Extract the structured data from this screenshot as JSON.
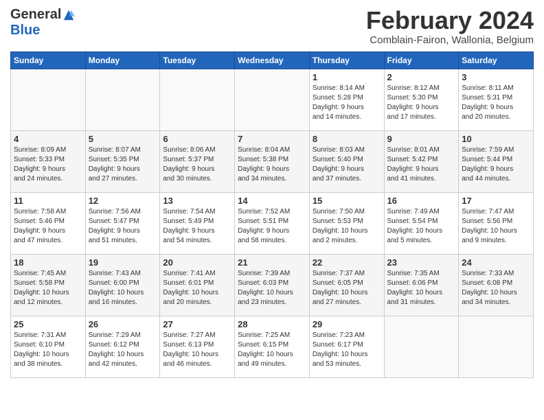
{
  "header": {
    "logo_general": "General",
    "logo_blue": "Blue",
    "month_title": "February 2024",
    "location": "Comblain-Fairon, Wallonia, Belgium"
  },
  "columns": [
    "Sunday",
    "Monday",
    "Tuesday",
    "Wednesday",
    "Thursday",
    "Friday",
    "Saturday"
  ],
  "weeks": [
    [
      {
        "day": "",
        "info": ""
      },
      {
        "day": "",
        "info": ""
      },
      {
        "day": "",
        "info": ""
      },
      {
        "day": "",
        "info": ""
      },
      {
        "day": "1",
        "info": "Sunrise: 8:14 AM\nSunset: 5:28 PM\nDaylight: 9 hours\nand 14 minutes."
      },
      {
        "day": "2",
        "info": "Sunrise: 8:12 AM\nSunset: 5:30 PM\nDaylight: 9 hours\nand 17 minutes."
      },
      {
        "day": "3",
        "info": "Sunrise: 8:11 AM\nSunset: 5:31 PM\nDaylight: 9 hours\nand 20 minutes."
      }
    ],
    [
      {
        "day": "4",
        "info": "Sunrise: 8:09 AM\nSunset: 5:33 PM\nDaylight: 9 hours\nand 24 minutes."
      },
      {
        "day": "5",
        "info": "Sunrise: 8:07 AM\nSunset: 5:35 PM\nDaylight: 9 hours\nand 27 minutes."
      },
      {
        "day": "6",
        "info": "Sunrise: 8:06 AM\nSunset: 5:37 PM\nDaylight: 9 hours\nand 30 minutes."
      },
      {
        "day": "7",
        "info": "Sunrise: 8:04 AM\nSunset: 5:38 PM\nDaylight: 9 hours\nand 34 minutes."
      },
      {
        "day": "8",
        "info": "Sunrise: 8:03 AM\nSunset: 5:40 PM\nDaylight: 9 hours\nand 37 minutes."
      },
      {
        "day": "9",
        "info": "Sunrise: 8:01 AM\nSunset: 5:42 PM\nDaylight: 9 hours\nand 41 minutes."
      },
      {
        "day": "10",
        "info": "Sunrise: 7:59 AM\nSunset: 5:44 PM\nDaylight: 9 hours\nand 44 minutes."
      }
    ],
    [
      {
        "day": "11",
        "info": "Sunrise: 7:58 AM\nSunset: 5:46 PM\nDaylight: 9 hours\nand 47 minutes."
      },
      {
        "day": "12",
        "info": "Sunrise: 7:56 AM\nSunset: 5:47 PM\nDaylight: 9 hours\nand 51 minutes."
      },
      {
        "day": "13",
        "info": "Sunrise: 7:54 AM\nSunset: 5:49 PM\nDaylight: 9 hours\nand 54 minutes."
      },
      {
        "day": "14",
        "info": "Sunrise: 7:52 AM\nSunset: 5:51 PM\nDaylight: 9 hours\nand 58 minutes."
      },
      {
        "day": "15",
        "info": "Sunrise: 7:50 AM\nSunset: 5:53 PM\nDaylight: 10 hours\nand 2 minutes."
      },
      {
        "day": "16",
        "info": "Sunrise: 7:49 AM\nSunset: 5:54 PM\nDaylight: 10 hours\nand 5 minutes."
      },
      {
        "day": "17",
        "info": "Sunrise: 7:47 AM\nSunset: 5:56 PM\nDaylight: 10 hours\nand 9 minutes."
      }
    ],
    [
      {
        "day": "18",
        "info": "Sunrise: 7:45 AM\nSunset: 5:58 PM\nDaylight: 10 hours\nand 12 minutes."
      },
      {
        "day": "19",
        "info": "Sunrise: 7:43 AM\nSunset: 6:00 PM\nDaylight: 10 hours\nand 16 minutes."
      },
      {
        "day": "20",
        "info": "Sunrise: 7:41 AM\nSunset: 6:01 PM\nDaylight: 10 hours\nand 20 minutes."
      },
      {
        "day": "21",
        "info": "Sunrise: 7:39 AM\nSunset: 6:03 PM\nDaylight: 10 hours\nand 23 minutes."
      },
      {
        "day": "22",
        "info": "Sunrise: 7:37 AM\nSunset: 6:05 PM\nDaylight: 10 hours\nand 27 minutes."
      },
      {
        "day": "23",
        "info": "Sunrise: 7:35 AM\nSunset: 6:06 PM\nDaylight: 10 hours\nand 31 minutes."
      },
      {
        "day": "24",
        "info": "Sunrise: 7:33 AM\nSunset: 6:08 PM\nDaylight: 10 hours\nand 34 minutes."
      }
    ],
    [
      {
        "day": "25",
        "info": "Sunrise: 7:31 AM\nSunset: 6:10 PM\nDaylight: 10 hours\nand 38 minutes."
      },
      {
        "day": "26",
        "info": "Sunrise: 7:29 AM\nSunset: 6:12 PM\nDaylight: 10 hours\nand 42 minutes."
      },
      {
        "day": "27",
        "info": "Sunrise: 7:27 AM\nSunset: 6:13 PM\nDaylight: 10 hours\nand 46 minutes."
      },
      {
        "day": "28",
        "info": "Sunrise: 7:25 AM\nSunset: 6:15 PM\nDaylight: 10 hours\nand 49 minutes."
      },
      {
        "day": "29",
        "info": "Sunrise: 7:23 AM\nSunset: 6:17 PM\nDaylight: 10 hours\nand 53 minutes."
      },
      {
        "day": "",
        "info": ""
      },
      {
        "day": "",
        "info": ""
      }
    ]
  ]
}
